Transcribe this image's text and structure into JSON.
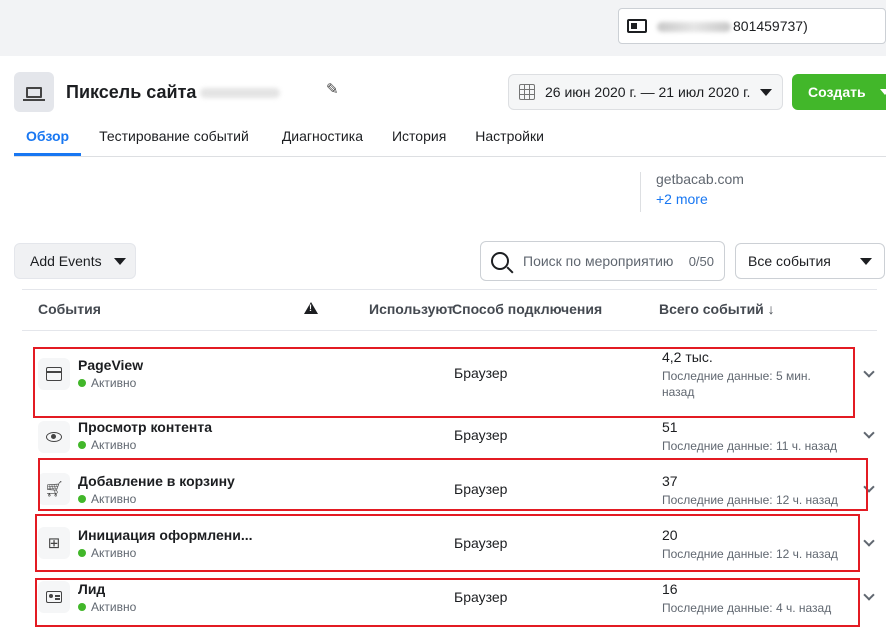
{
  "account": {
    "label": "Getbacab (ID: 1801459737)",
    "visible_suffix": "801459737)"
  },
  "header": {
    "pixel_title": "Пиксель сайта",
    "date_range": "26 июн 2020 г. — 21 июл 2020 г.",
    "create_button": "Создать"
  },
  "tabs": [
    "Обзор",
    "Тестирование событий",
    "Диагностика",
    "История",
    "Настройки"
  ],
  "domains": {
    "primary": "getbacab.com",
    "more": "+2 more"
  },
  "toolbar": {
    "add_events": "Add Events",
    "search_placeholder": "Поиск по мероприятию",
    "search_count": "0/50",
    "filter": "Все события"
  },
  "table": {
    "headers": {
      "events": "События",
      "used": "Используют",
      "connection": "Способ подключения",
      "total": "Всего событий ↓"
    },
    "rows": [
      {
        "icon": "browser-icon",
        "name": "PageView",
        "status": "Активно",
        "connection": "Браузер",
        "total": "4,2 тыс.",
        "last": "Последние данные: 5 мин. назад"
      },
      {
        "icon": "eye-icon",
        "name": "Просмотр контента",
        "status": "Активно",
        "connection": "Браузер",
        "total": "51",
        "last": "Последние данные: 11 ч. назад"
      },
      {
        "icon": "cart-icon",
        "name": "Добавление в корзину",
        "status": "Активно",
        "connection": "Браузер",
        "total": "37",
        "last": "Последние данные: 12 ч. назад"
      },
      {
        "icon": "basket-icon",
        "name": "Инициация оформлени...",
        "status": "Активно",
        "connection": "Браузер",
        "total": "20",
        "last": "Последние данные: 12 ч. назад"
      },
      {
        "icon": "contact-card-icon",
        "name": "Лид",
        "status": "Активно",
        "connection": "Браузер",
        "total": "16",
        "last": "Последние данные: 4 ч. назад"
      }
    ]
  },
  "colors": {
    "accent": "#1877f2",
    "create": "#42b72a",
    "highlight": "#e31b23",
    "active_dot": "#42b72a"
  }
}
